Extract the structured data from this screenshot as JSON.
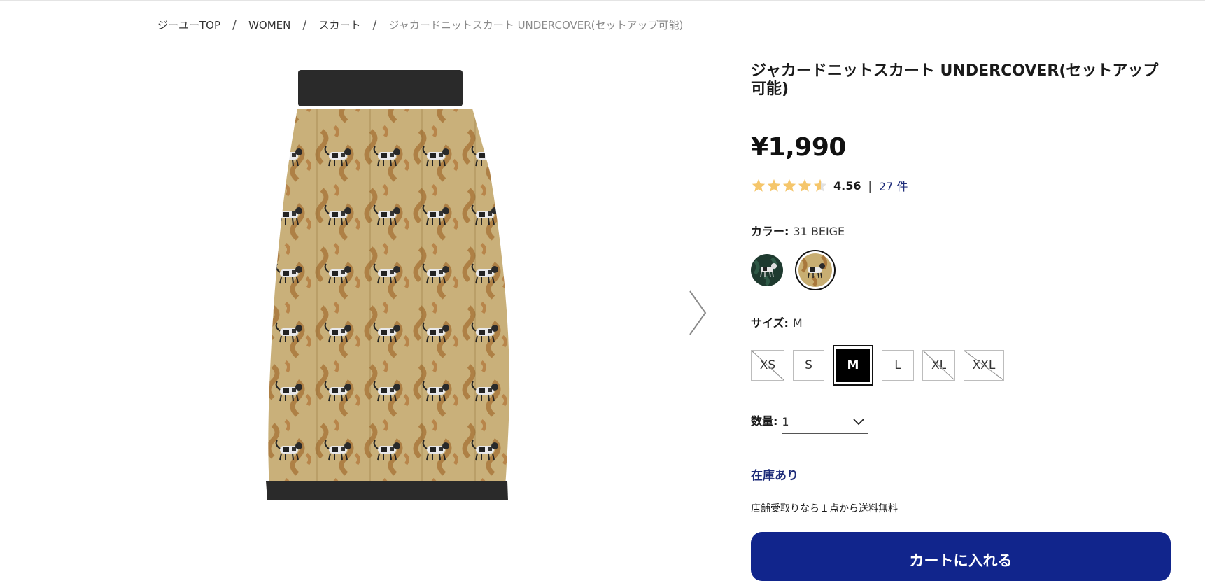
{
  "breadcrumb": {
    "items": [
      "ジーユーTOP",
      "WOMEN",
      "スカート"
    ],
    "current": "ジャカードニットスカート UNDERCOVER(セットアップ可能)",
    "separator": "/"
  },
  "product": {
    "title": "ジャカードニットスカート UNDERCOVER(セットアップ可能)",
    "price": "¥1,990",
    "rating": {
      "stars": 4.56,
      "value": "4.56",
      "separator": "|",
      "reviews": "27 件",
      "star_color": "#f5c66b"
    },
    "color": {
      "label": "カラー:",
      "selected": "31 BEIGE",
      "swatches": [
        {
          "name": "green",
          "color": "#1e3a2f",
          "selected": false
        },
        {
          "name": "beige",
          "color": "#c8ae72",
          "selected": true
        }
      ]
    },
    "size": {
      "label": "サイズ:",
      "selected": "M",
      "options": [
        {
          "label": "XS",
          "available": false
        },
        {
          "label": "S",
          "available": true
        },
        {
          "label": "M",
          "available": true,
          "selected": true
        },
        {
          "label": "L",
          "available": true
        },
        {
          "label": "XL",
          "available": false
        },
        {
          "label": "XXL",
          "available": false
        }
      ]
    },
    "quantity": {
      "label": "数量:",
      "value": "1"
    },
    "stock": "在庫あり",
    "shipping_note": "店舗受取りなら１点から送料無料",
    "cart_button": "カートに入れる"
  },
  "colors": {
    "primary": "#11258c",
    "link": "#1c2a78",
    "skirt_base": "#c8ae72",
    "skirt_band": "#2a2a2a"
  },
  "icons": {
    "next": "chevron-right-icon",
    "dropdown": "chevron-down-icon",
    "star": "star-icon"
  }
}
